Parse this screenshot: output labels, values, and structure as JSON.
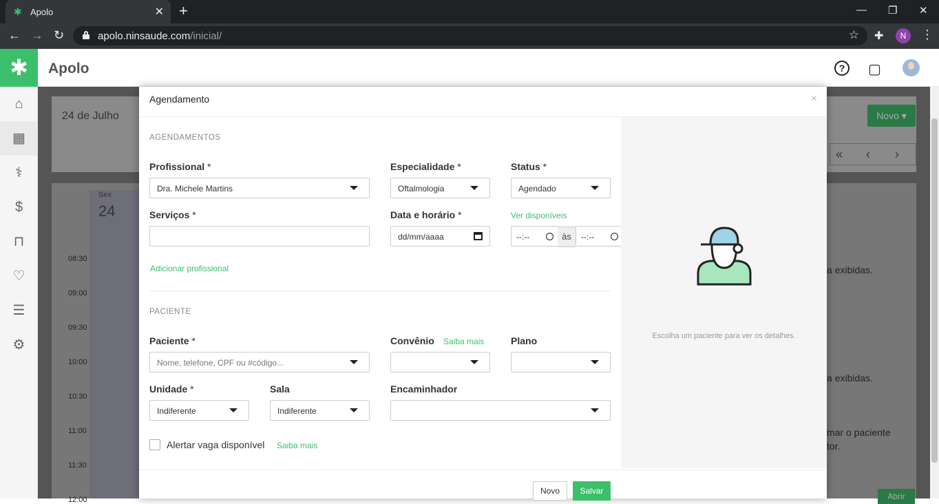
{
  "browser": {
    "tab_title": "Apolo",
    "tab_close": "✕",
    "new_tab": "+",
    "url_domain": "apolo.ninsaude.com",
    "url_path": "/inicial/",
    "profile_initial": "N"
  },
  "app": {
    "name": "Apolo",
    "brand_color": "#3cbf6a"
  },
  "background": {
    "date": "24 de Julho",
    "new_button": "Novo ▾",
    "day_name": "Sex",
    "day_number": "24",
    "times": [
      "08:30",
      "09:00",
      "09:30",
      "10:00",
      "10:30",
      "11:00",
      "11:30",
      "12:00"
    ],
    "snippet_1": "a exibidas.",
    "snippet_2": "a exibidas.",
    "snippet_3": "mar o paciente",
    "snippet_4": "tor.",
    "open_button": "Abrir"
  },
  "modal": {
    "title": "Agendamento",
    "close": "×",
    "section_appointments": "AGENDAMENTOS",
    "professional": {
      "label": "Profissional",
      "required": " *",
      "value": "Dra. Michele Martins"
    },
    "specialty": {
      "label": "Especialidade",
      "required": " *",
      "value": "Oftalmologia"
    },
    "status": {
      "label": "Status",
      "required": " *",
      "value": "Agendado"
    },
    "services": {
      "label": "Serviços",
      "required": " *",
      "value": ""
    },
    "datetime": {
      "label": "Data e horário",
      "required": " *",
      "date_placeholder": "dd/mm/aaaa",
      "time_start": "--:--",
      "time_separator": "às",
      "time_end": "--:--"
    },
    "see_available": "Ver disponíveis",
    "add_professional": "Adicionar profissional",
    "section_patient": "PACIENTE",
    "patient": {
      "label": "Paciente",
      "required": " *",
      "placeholder": "Nome, telefone, CPF ou #código..."
    },
    "insurance": {
      "label": "Convênio",
      "learn_more": "Saiba mais",
      "value": ""
    },
    "plan": {
      "label": "Plano",
      "value": ""
    },
    "unit": {
      "label": "Unidade",
      "required": " *",
      "value": "Indiferente"
    },
    "room": {
      "label": "Sala",
      "value": "Indiferente"
    },
    "referrer": {
      "label": "Encaminhador",
      "value": ""
    },
    "alert_vacancy": {
      "label": "Alertar vaga disponível",
      "learn_more": "Saiba mais"
    },
    "choose_patient_hint": "Escolha um paciente para ver os detalhes.",
    "btn_new": "Novo",
    "btn_save": "Salvar"
  },
  "icons": {
    "sidebar": [
      "home-icon",
      "calendar-icon",
      "stethoscope-icon",
      "money-icon",
      "bag-icon",
      "heartbeat-icon",
      "report-icon",
      "gear-icon"
    ]
  }
}
